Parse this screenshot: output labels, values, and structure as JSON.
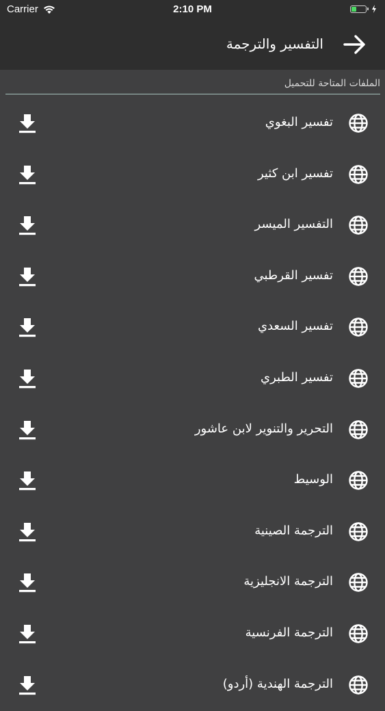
{
  "status_bar": {
    "carrier": "Carrier",
    "time": "2:10 PM",
    "battery_level": 0.35,
    "battery_color": "#4cd964"
  },
  "nav": {
    "title": "التفسير والترجمة",
    "back_icon": "arrow-right-icon"
  },
  "section": {
    "header": "الملفات المتاحة للتحميل"
  },
  "items": [
    {
      "label": "تفسير البغوي"
    },
    {
      "label": "تفسير ابن كثير"
    },
    {
      "label": "التفسير الميسر"
    },
    {
      "label": "تفسير القرطبي"
    },
    {
      "label": "تفسير السعدي"
    },
    {
      "label": "تفسير الطبري"
    },
    {
      "label": "التحرير والتنوير لابن عاشور"
    },
    {
      "label": "الوسيط"
    },
    {
      "label": "الترجمة الصينية"
    },
    {
      "label": "الترجمة الانجليزية"
    },
    {
      "label": "الترجمة الفرنسية"
    },
    {
      "label": "الترجمة الهندية (أردو)"
    }
  ],
  "colors": {
    "background": "#404041",
    "bar": "#2e2e2e",
    "divider": "#a7c3bd"
  }
}
